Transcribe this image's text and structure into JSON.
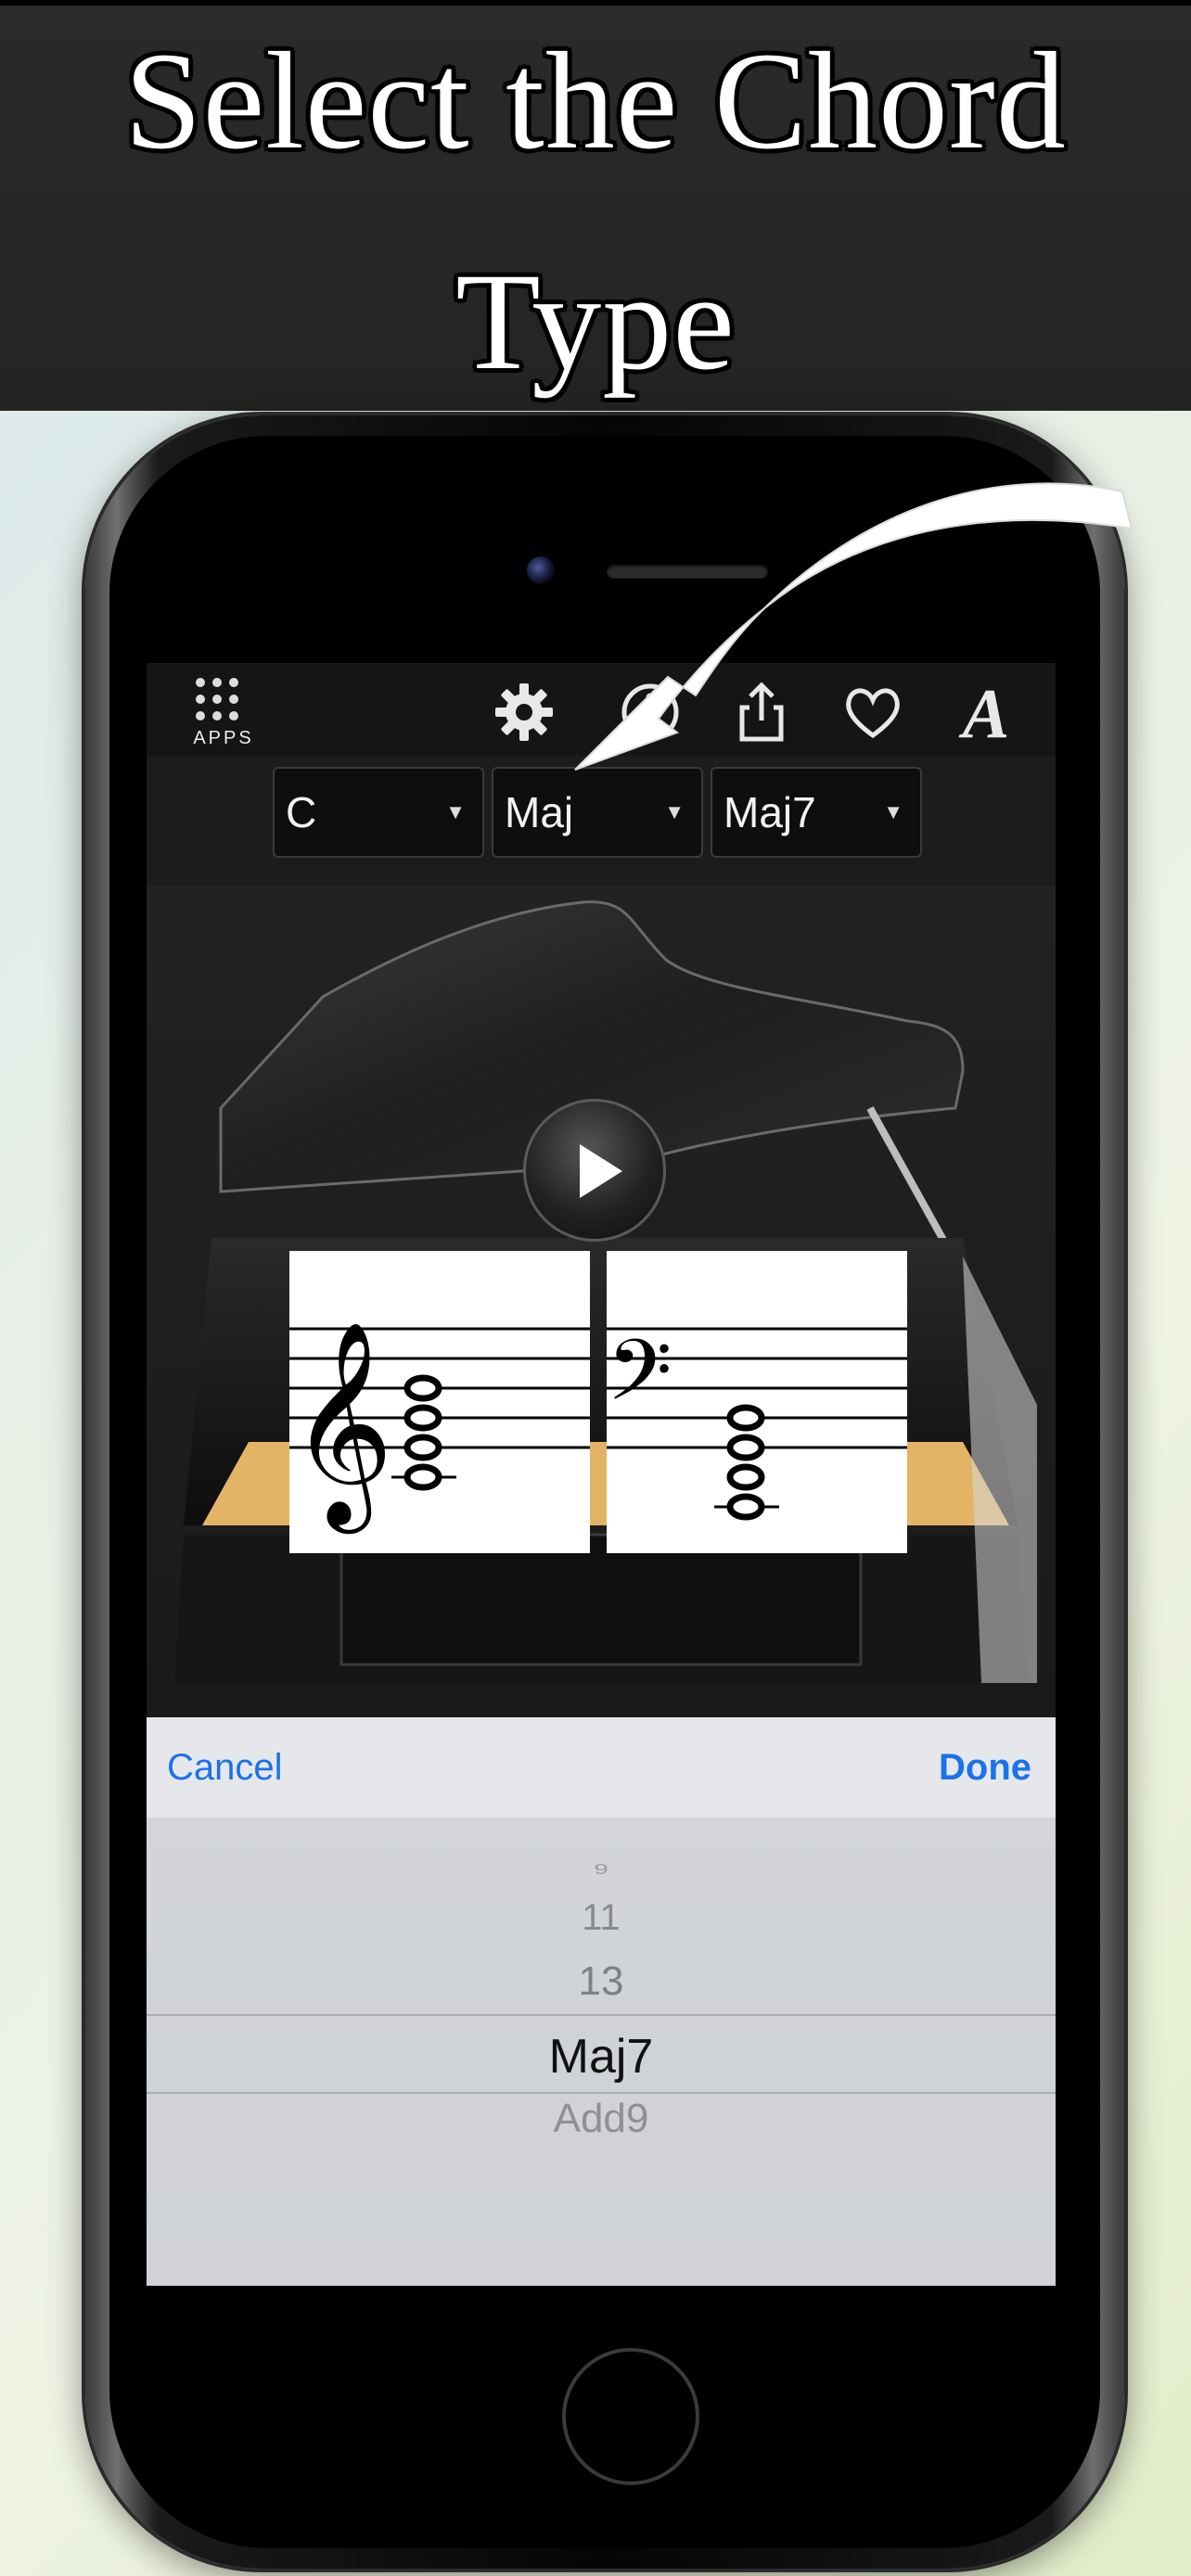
{
  "banner": {
    "line1": "Select the Chord",
    "line2": "Type"
  },
  "toolbar": {
    "apps_label": "APPS",
    "icons": [
      "grid-icon",
      "gear-icon",
      "info-icon",
      "share-icon",
      "heart-icon",
      "font-icon"
    ]
  },
  "selectors": {
    "root": "C",
    "quality": "Maj",
    "type": "Maj7"
  },
  "picker": {
    "cancel_label": "Cancel",
    "done_label": "Done",
    "items": [
      "9",
      "11",
      "13",
      "Maj7",
      "Add9"
    ],
    "selected": "Maj7"
  },
  "colors": {
    "accent": "#1a73e8",
    "banner_bg": "#262624",
    "screen_bg": "#1c1c1c",
    "picker_bg": "#c9ccd2"
  }
}
